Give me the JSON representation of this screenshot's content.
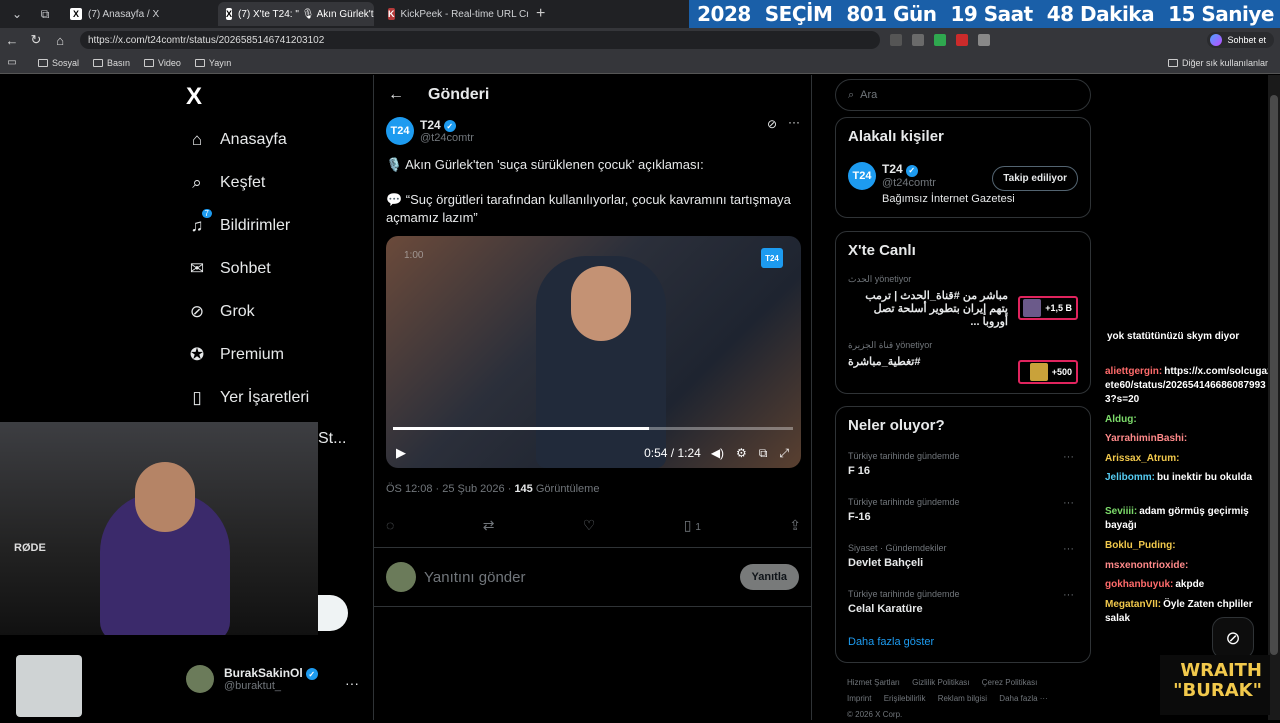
{
  "browser": {
    "tabs": [
      {
        "label": "(7) Anasayfa / X",
        "icon": "x-logo-icon"
      },
      {
        "label": "(7) X'te T24: \" 🎙 Akın Gürlek'ten",
        "icon": "x-logo-icon"
      },
      {
        "label": "KickPeek - Real-time URL Crawler",
        "icon": "kickpeek-icon"
      }
    ],
    "url": "https://x.com/t24comtr/status/2026585146741203102",
    "profile_label": "Sohbet et",
    "bookmarks": [
      "Sosyal",
      "Basın",
      "Video",
      "Yayın"
    ],
    "bookmarks_other": "Diğer sık kullanılanlar"
  },
  "countdown": {
    "year": "2028",
    "label": "SEÇİM",
    "days": "801 Gün",
    "hours": "19 Saat",
    "minutes": "48 Dakika",
    "seconds": "15 Saniye"
  },
  "nav": {
    "logo": "X",
    "items": [
      {
        "label": "Anasayfa",
        "icon": "home-icon"
      },
      {
        "label": "Keşfet",
        "icon": "search-icon"
      },
      {
        "label": "Bildirimler",
        "icon": "bell-icon",
        "badge": "7"
      },
      {
        "label": "Sohbet",
        "icon": "mail-icon"
      },
      {
        "label": "Grok",
        "icon": "grok-icon"
      },
      {
        "label": "Premium",
        "icon": "premium-icon"
      },
      {
        "label": "Yer İşaretleri",
        "icon": "bookmark-icon"
      }
    ],
    "partial": "St...",
    "user": {
      "name": "BurakSakinOl",
      "handle": "@buraktut_"
    }
  },
  "post": {
    "header": "Gönderi",
    "author": {
      "name": "T24",
      "handle": "@t24comtr",
      "avatar": "T24"
    },
    "text1": "🎙️ Akın Gürlek'ten 'suça sürüklenen çocuk' açıklaması:",
    "text2": "💬 “Suç örgütleri tarafından kullanılıyorlar, çocuk kavramını tartışmaya açmamız lazım”",
    "video": {
      "current": "0:54",
      "duration": "1:24",
      "separator": "/",
      "progress": 0.64,
      "badge": "T24",
      "overlay_time": "1:00"
    },
    "meta_time": "ÖS 12:08 · 25 Şub 2026 ·",
    "views": "145",
    "views_label": "Görüntüleme",
    "bookmarks_count": "1",
    "reply_placeholder": "Yanıtını gönder",
    "reply_button": "Yanıtla"
  },
  "sidebar": {
    "search_placeholder": "Ara",
    "related_title": "Alakalı kişiler",
    "related": {
      "name": "T24",
      "handle": "@t24comtr",
      "bio": "Bağımsız İnternet Gazetesi",
      "follow": "Takip ediliyor"
    },
    "live_title": "X'te Canlı",
    "live": [
      {
        "host": "الحدث",
        "status": "yönetiyor",
        "title": "مباشر من #قناة_الحدث | ترمب يتهم إيران بتطوير أسلحة تصل أوروبا ...",
        "count": "+1,5 B"
      },
      {
        "host": "قناة الجزيرة",
        "status": "yönetiyor",
        "title": "#تغطية_مباشرة",
        "count": "+500"
      }
    ],
    "trends_title": "Neler oluyor?",
    "trends": [
      {
        "context": "Türkiye tarihinde gündemde",
        "name": "F 16"
      },
      {
        "context": "Türkiye tarihinde gündemde",
        "name": "F-16"
      },
      {
        "context": "Siyaset · Gündemdekiler",
        "name": "Devlet Bahçeli"
      },
      {
        "context": "Türkiye tarihinde gündemde",
        "name": "Celal Karatüre"
      }
    ],
    "show_more": "Daha fazla göster",
    "footer": [
      "Hizmet Şartları",
      "Gizlilik Politikası",
      "Çerez Politikası",
      "Imprint",
      "Erişilebilirlik",
      "Reklam bilgisi",
      "Daha fazla ···",
      "© 2026 X Corp."
    ]
  },
  "chat": [
    {
      "user": "",
      "text": "yok statütünüzü skym diyor",
      "color": "#ffffff"
    },
    {
      "user": "aliettgergin:",
      "text": "https://x.com/solcugazete60/status/2026541466860879933?s=20",
      "color": "#ff6b6b"
    },
    {
      "user": "Aldug:",
      "text": "",
      "color": "#7ddc6b"
    },
    {
      "user": "YarrahiminBashi:",
      "text": "",
      "color": "#ff8a8a"
    },
    {
      "user": "Arissax_Atrum:",
      "text": "",
      "color": "#f2c94c"
    },
    {
      "user": "Jelibomm:",
      "text": "bu inektir bu okulda",
      "color": "#56ccf2"
    },
    {
      "user": "Seviiii:",
      "text": "adam görmüş geçirmiş bayağı",
      "color": "#7ddc6b"
    },
    {
      "user": "Boklu_Puding:",
      "text": "",
      "color": "#f2c94c"
    },
    {
      "user": "msxenontrioxide:",
      "text": "",
      "color": "#ff8a8a"
    },
    {
      "user": "gokhanbuyuk:",
      "text": "akpde",
      "color": "#ff6b6b"
    },
    {
      "user": "MegatanVII:",
      "text": "Öyle Zaten chpliler salak",
      "color": "#f2c94c"
    }
  ],
  "overlay": {
    "wraith": "WRAITH",
    "burak": "\"BURAK\"",
    "mic_brand": "RØDE"
  },
  "colors": {
    "accent": "#1d9bf0",
    "countdown_bg": "#1a5fa8",
    "live_border": "#e0245e"
  }
}
